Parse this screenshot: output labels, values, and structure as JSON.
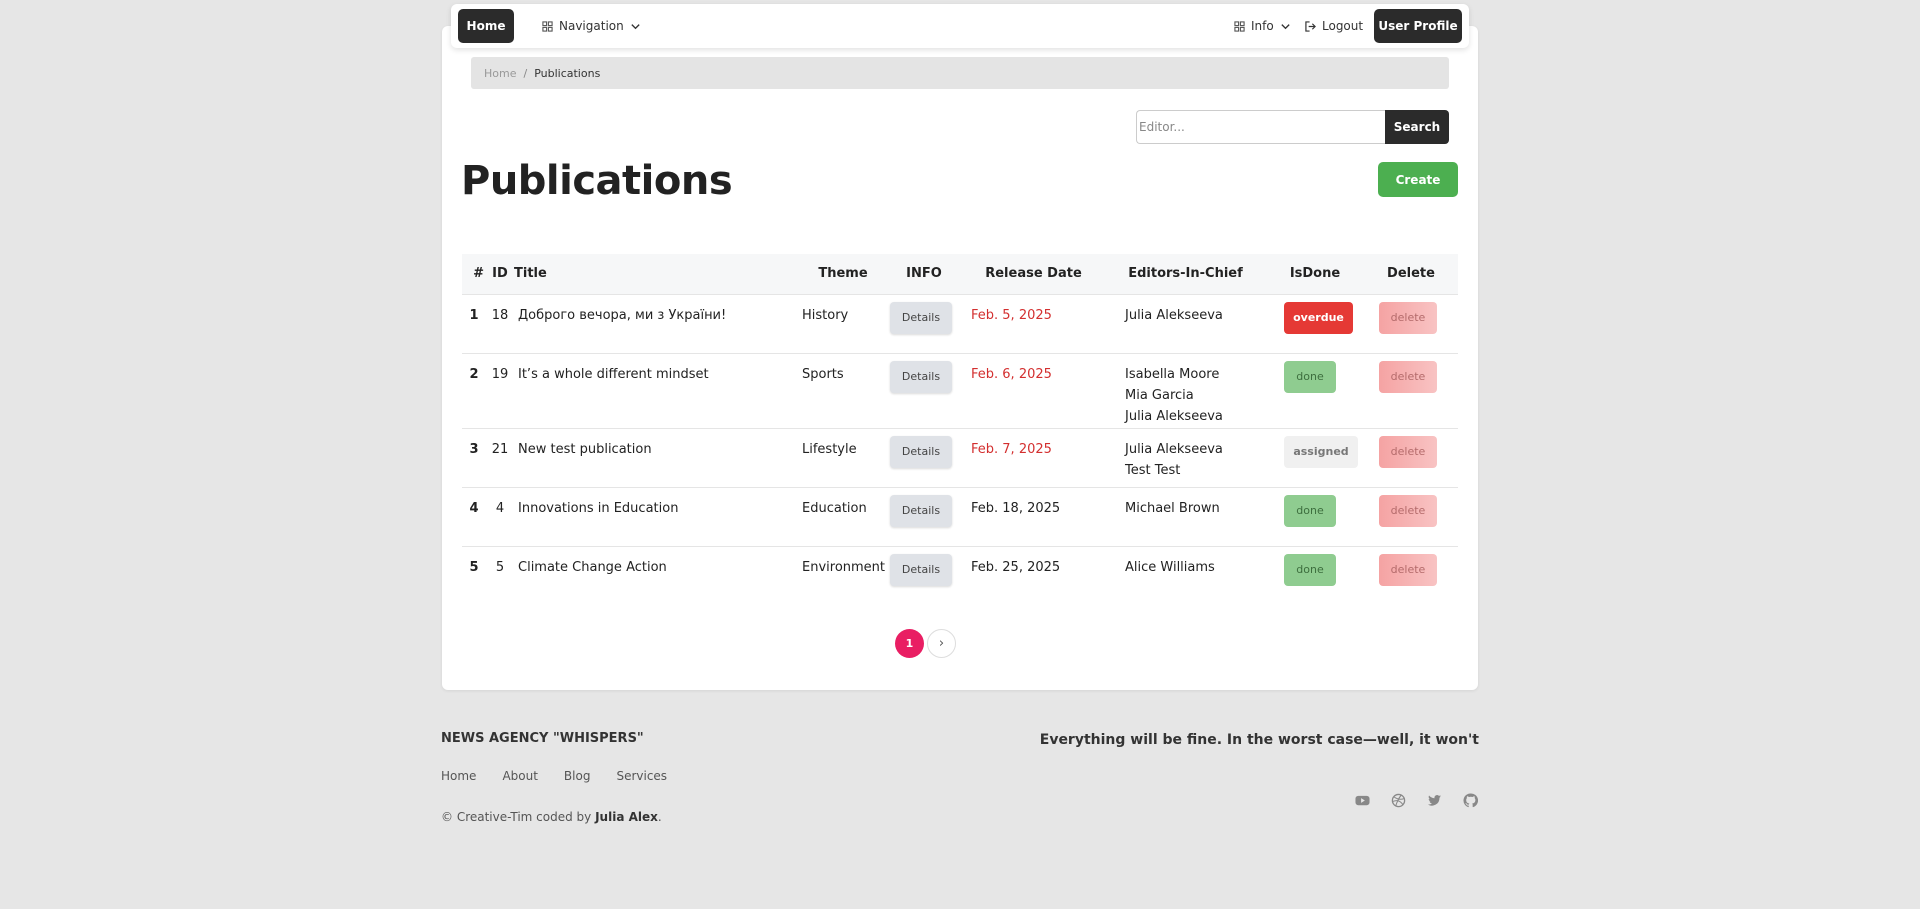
{
  "nav": {
    "home": "Home",
    "navigation": "Navigation",
    "info": "Info",
    "logout": "Logout",
    "user_profile": "User Profile"
  },
  "breadcrumb": {
    "home": "Home",
    "separator": "/",
    "current": "Publications"
  },
  "search": {
    "placeholder": "Editor...",
    "button": "Search"
  },
  "page": {
    "title": "Publications",
    "create": "Create"
  },
  "table": {
    "headers": {
      "num": "#",
      "id": "ID",
      "title": "Title",
      "theme": "Theme",
      "info": "INFO",
      "release_date": "Release Date",
      "editors": "Editors-In-Chief",
      "is_done": "IsDone",
      "delete": "Delete"
    },
    "rows": [
      {
        "num": "1",
        "id": "18",
        "title": "Доброго вечора, ми з України!",
        "theme": "History",
        "details": "Details",
        "date": "Feb. 5, 2025",
        "date_overdue": true,
        "editors": [
          "Julia Alekseeva"
        ],
        "status": "overdue",
        "delete": "delete"
      },
      {
        "num": "2",
        "id": "19",
        "title": "It’s a whole different mindset",
        "theme": "Sports",
        "details": "Details",
        "date": "Feb. 6, 2025",
        "date_overdue": true,
        "editors": [
          "Isabella Moore",
          "Mia Garcia",
          "Julia Alekseeva"
        ],
        "status": "done",
        "delete": "delete"
      },
      {
        "num": "3",
        "id": "21",
        "title": "New test publication",
        "theme": "Lifestyle",
        "details": "Details",
        "date": "Feb. 7, 2025",
        "date_overdue": true,
        "editors": [
          "Julia Alekseeva",
          "Test Test"
        ],
        "status": "assigned",
        "delete": "delete"
      },
      {
        "num": "4",
        "id": "4",
        "title": "Innovations in Education",
        "theme": "Education",
        "details": "Details",
        "date": "Feb. 18, 2025",
        "date_overdue": false,
        "editors": [
          "Michael Brown"
        ],
        "status": "done",
        "delete": "delete"
      },
      {
        "num": "5",
        "id": "5",
        "title": "Climate Change Action",
        "theme": "Environment",
        "details": "Details",
        "date": "Feb. 25, 2025",
        "date_overdue": false,
        "editors": [
          "Alice Williams"
        ],
        "status": "done",
        "delete": "delete"
      }
    ]
  },
  "pagination": {
    "current": "1",
    "next": "›"
  },
  "footer": {
    "brand": "NEWS AGENCY \"WHISPERS\"",
    "tagline": "Everything will be fine. In the worst case—well, it won't",
    "links": [
      "Home",
      "About",
      "Blog",
      "Services"
    ],
    "copy_prefix": "© Creative-Tim coded by",
    "copy_author": "Julia Alex",
    "copy_suffix": ".",
    "icons": [
      "youtube-icon",
      "dribbble-icon",
      "twitter-icon",
      "github-icon"
    ]
  },
  "colors": {
    "overdue": "#e53935",
    "done": "#8fcc90",
    "create": "#4caf50",
    "page_active": "#e91e63",
    "dark_button": "#2b2b2b"
  }
}
